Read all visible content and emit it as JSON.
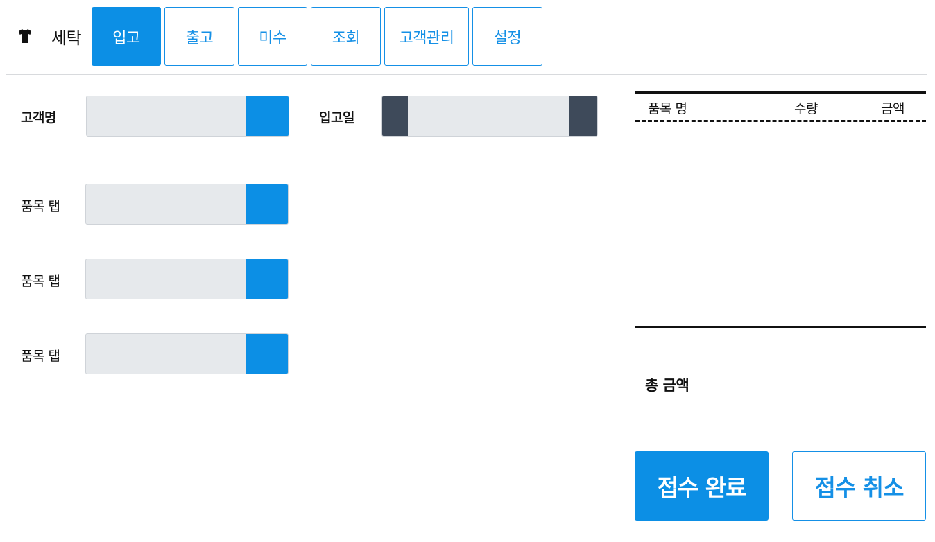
{
  "brand": {
    "icon": "shirt-icon",
    "label": "세탁"
  },
  "tabs": [
    {
      "label": "입고",
      "active": true
    },
    {
      "label": "출고",
      "active": false
    },
    {
      "label": "미수",
      "active": false
    },
    {
      "label": "조회",
      "active": false
    },
    {
      "label": "고객관리",
      "active": false
    },
    {
      "label": "설정",
      "active": false
    }
  ],
  "form": {
    "customer_label": "고객명",
    "customer_value": "",
    "date_label": "입고일",
    "date_value": "",
    "item_rows": [
      {
        "label": "품목 탭",
        "value": ""
      },
      {
        "label": "품목 탭",
        "value": ""
      },
      {
        "label": "품목 탭",
        "value": ""
      }
    ]
  },
  "receipt": {
    "col_item": "품목 명",
    "col_qty": "수량",
    "col_amount": "금액",
    "total_label": "총 금액"
  },
  "actions": {
    "confirm": "접수 완료",
    "cancel": "접수 취소"
  },
  "colors": {
    "accent": "#0c8fe5",
    "dark_button": "#3e4a5a",
    "field_bg": "#e6e9ec"
  }
}
